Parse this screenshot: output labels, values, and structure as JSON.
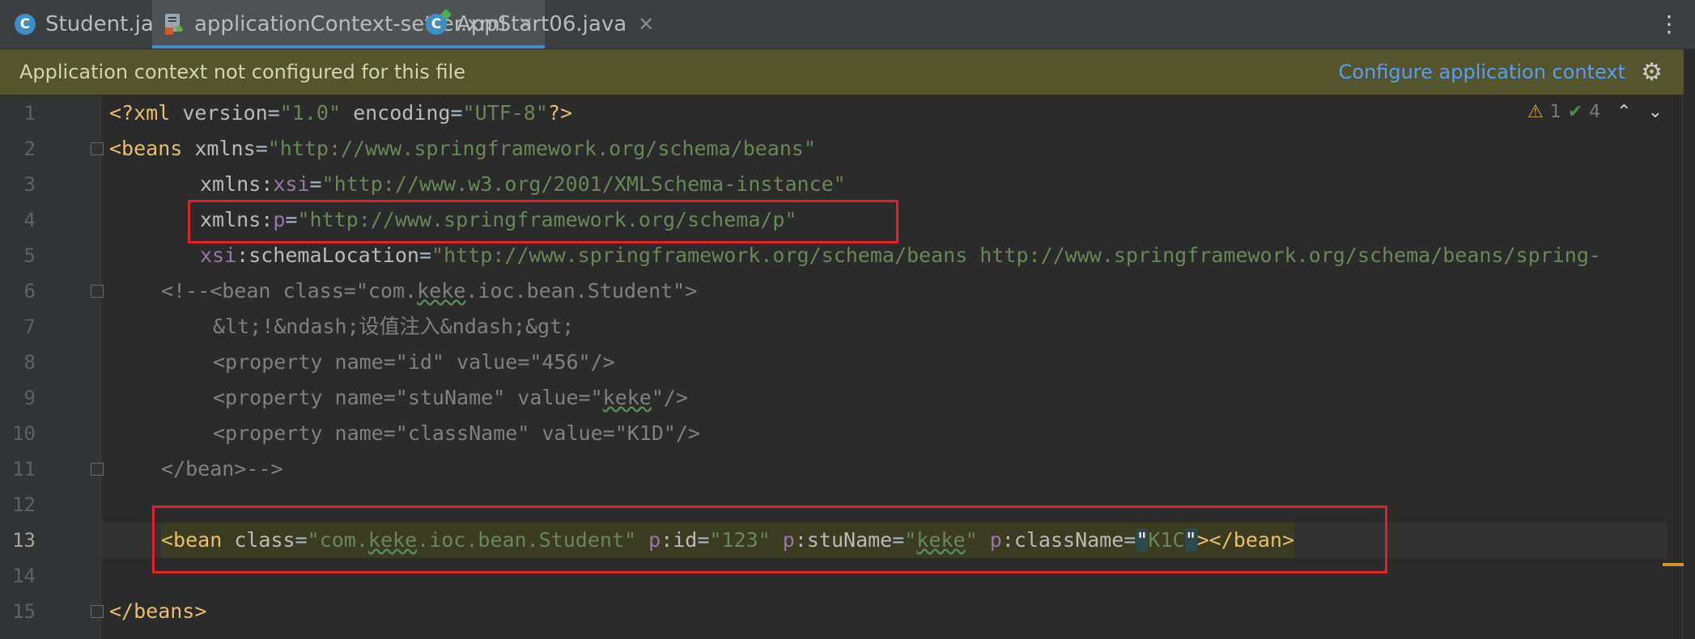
{
  "tabs": [
    {
      "label": "Student.java",
      "icon": "java-class-icon",
      "icon_letter": "C"
    },
    {
      "label": "applicationContext-setter.xml",
      "icon": "xml-file-icon",
      "active": true
    },
    {
      "label": "AppStart06.java",
      "icon": "java-main-class-icon",
      "icon_letter": "C"
    }
  ],
  "banner": {
    "message": "Application context not configured for this file",
    "link": "Configure application context"
  },
  "inspection": {
    "warnings": "1",
    "passed": "4"
  },
  "current_line": 13,
  "lines": [
    {
      "num": "1"
    },
    {
      "num": "2"
    },
    {
      "num": "3"
    },
    {
      "num": "4"
    },
    {
      "num": "5"
    },
    {
      "num": "6"
    },
    {
      "num": "7"
    },
    {
      "num": "8"
    },
    {
      "num": "9"
    },
    {
      "num": "10"
    },
    {
      "num": "11"
    },
    {
      "num": "12"
    },
    {
      "num": "13"
    },
    {
      "num": "14"
    },
    {
      "num": "15"
    }
  ],
  "code": {
    "l1": {
      "open": "<?xml ",
      "a1": "version",
      "v1": "\"1.0\"",
      "a2": "encoding",
      "v2": "\"UTF-8\"",
      "close": "?>"
    },
    "l2": {
      "tag": "<beans",
      "attr": "xmlns",
      "val": "\"http://www.springframework.org/schema/beans\""
    },
    "l3": {
      "attr": "xmlns:",
      "ns": "xsi",
      "val": "\"http://www.w3.org/2001/XMLSchema-instance\""
    },
    "l4": {
      "attr": "xmlns:",
      "ns": "p",
      "val": "\"http://www.springframework.org/schema/p\""
    },
    "l5": {
      "ns": "xsi",
      "attr": ":schemaLocation",
      "val": "\"http://www.springframework.org/schema/beans http://www.springframework.org/schema/beans/spring-"
    },
    "l6": {
      "pre": "<!--<bean class=\"com.",
      "squig": "keke",
      "post": ".ioc.bean.Student\">"
    },
    "l7": {
      "text": "&lt;!&ndash;设值注入&ndash;&gt;"
    },
    "l8": {
      "text": "<property name=\"id\" value=\"456\"/>"
    },
    "l9": {
      "pre": "<property name=\"stuName\" value=\"",
      "squig": "keke",
      "post": "\"/>"
    },
    "l10": {
      "text": "<property name=\"className\" value=\"K1D\"/>"
    },
    "l11": {
      "text": "</bean>-->"
    },
    "l13": {
      "tag": "<bean",
      "a1": "class",
      "v1_pre": "\"com.",
      "v1_squig": "keke",
      "v1_post": ".ioc.bean.Student\"",
      "ns2": "p",
      "a2": ":id",
      "v2": "\"123\"",
      "ns3": "p",
      "a3": ":stuName",
      "v3_q1": "\"",
      "v3_squig": "keke",
      "v3_q2": "\"",
      "ns4": "p",
      "a4": ":className",
      "v4_q1": "\"",
      "v4": "K1C",
      "v4_q2": "\"",
      "close": "></bean>"
    },
    "l15": {
      "tag": "</beans>"
    }
  },
  "colors": {
    "accent": "#4a88c7",
    "highlight_box": "#e0202a",
    "banner_bg": "#54542d"
  }
}
